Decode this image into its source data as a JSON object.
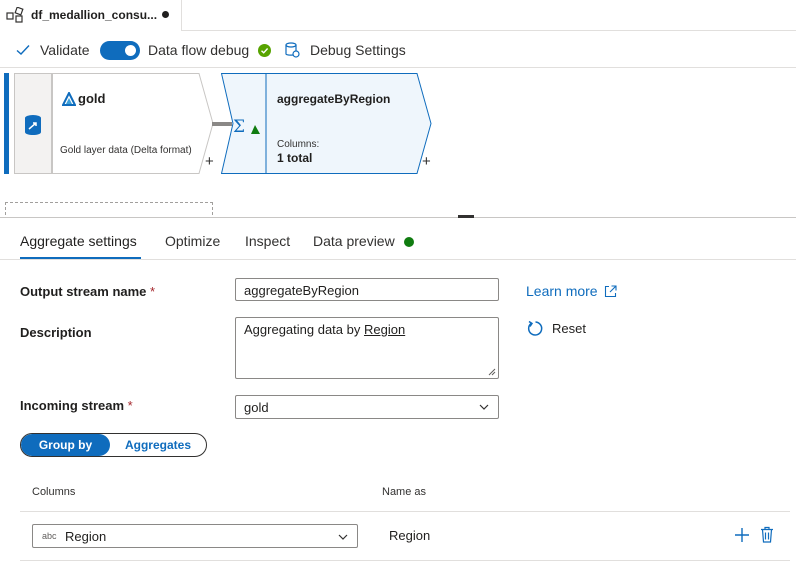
{
  "tab": {
    "title": "df_medallion_consu..."
  },
  "toolbar": {
    "validate_label": "Validate",
    "debug_label": "Data flow debug",
    "debug_on": true,
    "debug_settings_label": "Debug Settings"
  },
  "canvas": {
    "source_node": {
      "title": "gold",
      "description": "Gold layer data (Delta format)"
    },
    "aggregate_node": {
      "title": "aggregateByRegion",
      "columns_label": "Columns:",
      "columns_count": "1 total"
    },
    "add_symbol": "+"
  },
  "panel_tabs": {
    "aggregate_settings": "Aggregate settings",
    "optimize": "Optimize",
    "inspect": "Inspect",
    "data_preview": "Data preview"
  },
  "form": {
    "output_stream_label": "Output stream name",
    "output_stream_value": "aggregateByRegion",
    "required_marker": "*",
    "description_label": "Description",
    "description_prefix": "Aggregating data by ",
    "description_link_word": "Region",
    "incoming_stream_label": "Incoming stream",
    "incoming_stream_value": "gold",
    "learn_more": "Learn more",
    "reset": "Reset"
  },
  "segmented": {
    "group_by": "Group by",
    "aggregates": "Aggregates"
  },
  "group_by_table": {
    "headers": {
      "columns": "Columns",
      "name_as": "Name as"
    },
    "rows": [
      {
        "type": "abc",
        "column": "Region",
        "name_as": "Region"
      }
    ]
  },
  "colors": {
    "accent": "#0f6cbd",
    "success": "#107c10",
    "required": "#a4262c"
  }
}
